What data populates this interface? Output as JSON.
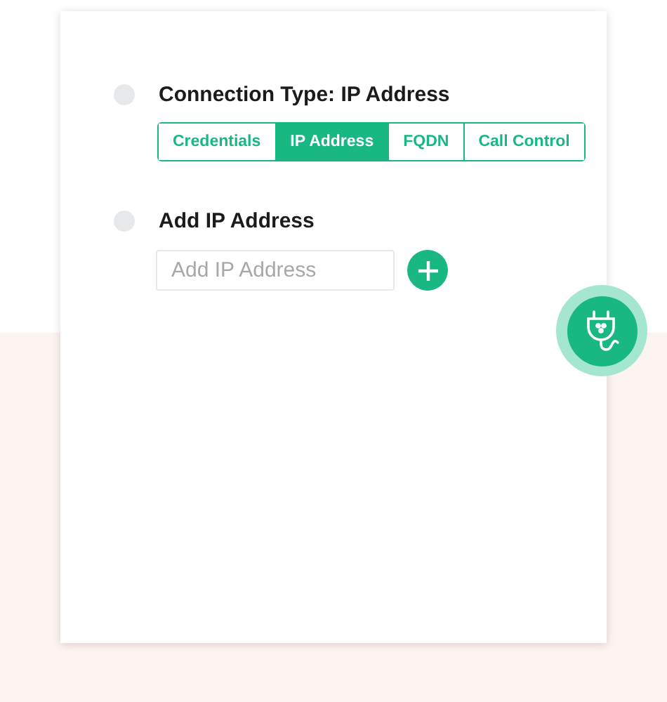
{
  "sections": [
    {
      "kind": "tabs",
      "title": "Connection Type: IP Address",
      "tabs": [
        {
          "label": "Credentials",
          "selected": false
        },
        {
          "label": "IP Address",
          "selected": true
        },
        {
          "label": "FQDN",
          "selected": false
        },
        {
          "label": "Call Control",
          "selected": false
        }
      ]
    },
    {
      "kind": "input",
      "title": "Add IP Address",
      "placeholder": "Add IP Address"
    }
  ]
}
